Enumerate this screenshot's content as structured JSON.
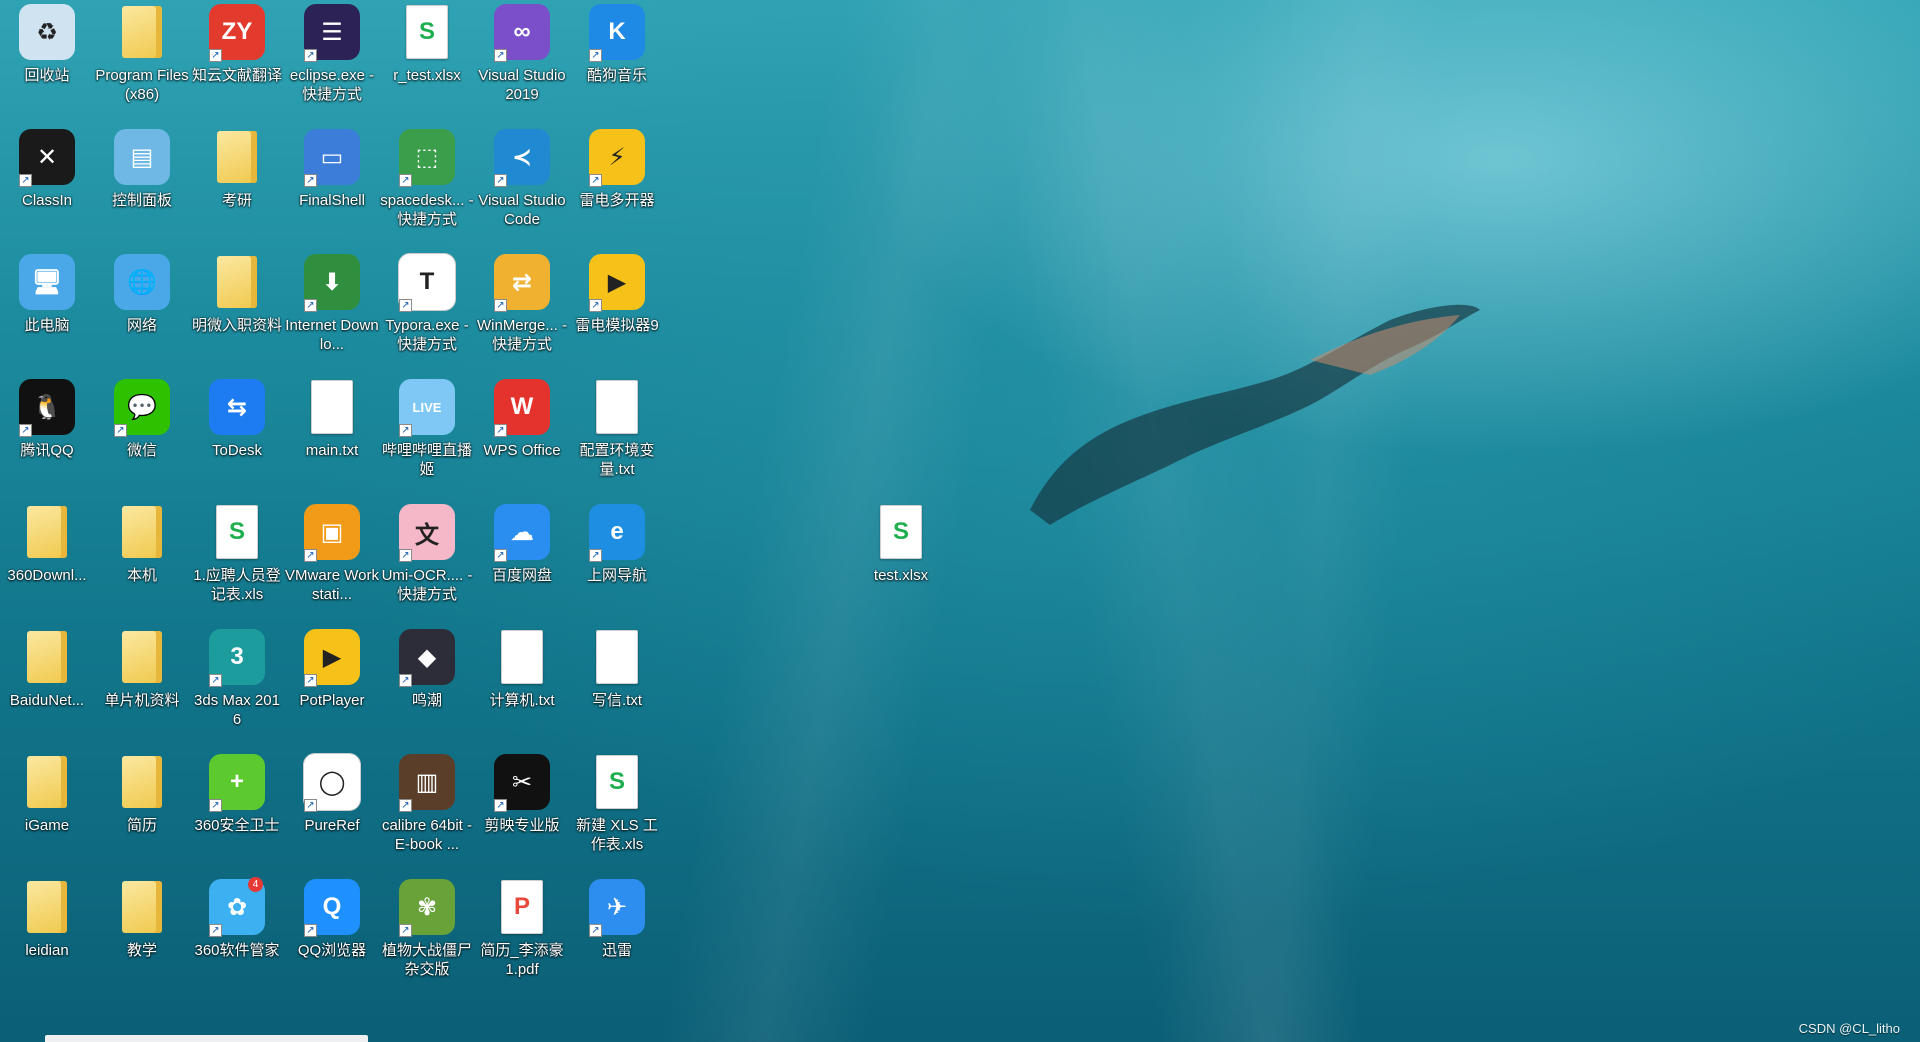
{
  "desktop": {
    "icons": [
      {
        "id": "recycle",
        "label": "回收站",
        "type": "system",
        "icon": "recycle-bin-icon",
        "color": "#cfe3f0",
        "glyph": "♻",
        "shortcut": false
      },
      {
        "id": "progfiles",
        "label": "Program Files (x86)",
        "type": "folder",
        "icon": "folder-icon",
        "shortcut": false
      },
      {
        "id": "zhiyun",
        "label": "知云文献翻译",
        "type": "app",
        "icon": "zhiyun-icon",
        "color": "#e23b2e",
        "glyph": "ZY",
        "shortcut": true
      },
      {
        "id": "eclipse",
        "label": "eclipse.exe - 快捷方式",
        "type": "app",
        "icon": "eclipse-icon",
        "color": "#2c2255",
        "glyph": "☰",
        "shortcut": true
      },
      {
        "id": "rtest",
        "label": "r_test.xlsx",
        "type": "doc",
        "icon": "spreadsheet-icon",
        "color": "#1fae4e",
        "glyph": "S",
        "shortcut": false
      },
      {
        "id": "vs2019",
        "label": "Visual Studio 2019",
        "type": "app",
        "icon": "visual-studio-icon",
        "color": "#7a4fc9",
        "glyph": "∞",
        "shortcut": true
      },
      {
        "id": "kugou",
        "label": "酷狗音乐",
        "type": "app",
        "icon": "kugou-icon",
        "color": "#1f8ae6",
        "glyph": "K",
        "shortcut": true
      },
      {
        "id": "classin",
        "label": "ClassIn",
        "type": "app",
        "icon": "classin-icon",
        "color": "#1a1a1a",
        "glyph": "✕",
        "shortcut": true
      },
      {
        "id": "control",
        "label": "控制面板",
        "type": "system",
        "icon": "control-panel-icon",
        "color": "#6fb8e6",
        "glyph": "▤",
        "shortcut": false
      },
      {
        "id": "kaoyan",
        "label": "考研",
        "type": "folder",
        "icon": "folder-icon",
        "shortcut": false
      },
      {
        "id": "finalshell",
        "label": "FinalShell",
        "type": "app",
        "icon": "finalshell-icon",
        "color": "#3b7dd8",
        "glyph": "▭",
        "shortcut": true
      },
      {
        "id": "spacedesk",
        "label": "spacedesk... - 快捷方式",
        "type": "app",
        "icon": "spacedesk-icon",
        "color": "#3a9e4a",
        "glyph": "⬚",
        "shortcut": true
      },
      {
        "id": "vscode",
        "label": "Visual Studio Code",
        "type": "app",
        "icon": "vscode-icon",
        "color": "#1f8ad2",
        "glyph": "≺",
        "shortcut": true
      },
      {
        "id": "ldmulti",
        "label": "雷电多开器",
        "type": "app",
        "icon": "leidian-multi-icon",
        "color": "#f6c21a",
        "glyph": "⚡",
        "shortcut": true
      },
      {
        "id": "thispc",
        "label": "此电脑",
        "type": "system",
        "icon": "computer-icon",
        "color": "#4aa8e8",
        "glyph": "🖥",
        "shortcut": false
      },
      {
        "id": "network",
        "label": "网络",
        "type": "system",
        "icon": "network-icon",
        "color": "#4aa8e8",
        "glyph": "🌐",
        "shortcut": false
      },
      {
        "id": "mingwei",
        "label": "明微入职资料",
        "type": "folder",
        "icon": "folder-icon",
        "shortcut": false
      },
      {
        "id": "idm",
        "label": "Internet Downlo...",
        "type": "app",
        "icon": "idm-icon",
        "color": "#2f8f3f",
        "glyph": "⬇",
        "shortcut": true
      },
      {
        "id": "typora",
        "label": "Typora.exe - 快捷方式",
        "type": "app",
        "icon": "typora-icon",
        "color": "#ffffff",
        "glyph": "T",
        "shortcut": true
      },
      {
        "id": "winmerge",
        "label": "WinMerge... - 快捷方式",
        "type": "app",
        "icon": "winmerge-icon",
        "color": "#f0b030",
        "glyph": "⇄",
        "shortcut": true
      },
      {
        "id": "ld9",
        "label": "雷电模拟器9",
        "type": "app",
        "icon": "leidian-emulator-icon",
        "color": "#f6c21a",
        "glyph": "▶",
        "shortcut": true
      },
      {
        "id": "qq",
        "label": "腾讯QQ",
        "type": "app",
        "icon": "qq-penguin-icon",
        "color": "#111111",
        "glyph": "🐧",
        "shortcut": true
      },
      {
        "id": "wechat",
        "label": "微信",
        "type": "app",
        "icon": "wechat-icon",
        "color": "#2dc100",
        "glyph": "💬",
        "shortcut": true
      },
      {
        "id": "todesk",
        "label": "ToDesk",
        "type": "app",
        "icon": "todesk-icon",
        "color": "#1e7cf2",
        "glyph": "⇆",
        "shortcut": false
      },
      {
        "id": "maintxt",
        "label": "main.txt",
        "type": "doc",
        "icon": "text-file-icon",
        "shortcut": false
      },
      {
        "id": "bilibili",
        "label": "哔哩哔哩直播姬",
        "type": "app",
        "icon": "bilibili-live-icon",
        "color": "#7fc8f5",
        "glyph": "LIVE",
        "shortcut": true
      },
      {
        "id": "wps",
        "label": "WPS Office",
        "type": "app",
        "icon": "wps-icon",
        "color": "#e4332c",
        "glyph": "W",
        "shortcut": true
      },
      {
        "id": "envtxt",
        "label": "配置环境变量.txt",
        "type": "doc",
        "icon": "text-file-icon",
        "shortcut": false
      },
      {
        "id": "dl360",
        "label": "360Downl...",
        "type": "folder",
        "icon": "folder-icon",
        "shortcut": false
      },
      {
        "id": "benji",
        "label": "本机",
        "type": "folder",
        "icon": "folder-icon",
        "shortcut": false
      },
      {
        "id": "recruit",
        "label": "1.应聘人员登记表.xls",
        "type": "doc",
        "icon": "spreadsheet-icon",
        "color": "#1fae4e",
        "glyph": "S",
        "shortcut": false
      },
      {
        "id": "vmware",
        "label": "VMware Workstati...",
        "type": "app",
        "icon": "vmware-icon",
        "color": "#f29b18",
        "glyph": "▣",
        "shortcut": true
      },
      {
        "id": "umiocr",
        "label": "Umi-OCR.... - 快捷方式",
        "type": "app",
        "icon": "umi-ocr-icon",
        "color": "#f5b8c9",
        "glyph": "文",
        "shortcut": true
      },
      {
        "id": "baidupan",
        "label": "百度网盘",
        "type": "app",
        "icon": "baidu-netdisk-icon",
        "color": "#2a8df0",
        "glyph": "☁",
        "shortcut": true
      },
      {
        "id": "ie",
        "label": "上网导航",
        "type": "app",
        "icon": "ie-browser-icon",
        "color": "#1e8ee3",
        "glyph": "e",
        "shortcut": true
      },
      {
        "id": "baidunet",
        "label": "BaiduNet...",
        "type": "folder",
        "icon": "folder-icon",
        "shortcut": false
      },
      {
        "id": "mcu",
        "label": "单片机资料",
        "type": "folder",
        "icon": "folder-icon",
        "shortcut": false
      },
      {
        "id": "3dsmax",
        "label": "3ds Max 2016",
        "type": "app",
        "icon": "3ds-max-icon",
        "color": "#1c9c9c",
        "glyph": "3",
        "shortcut": true
      },
      {
        "id": "potplayer",
        "label": "PotPlayer",
        "type": "app",
        "icon": "potplayer-icon",
        "color": "#f6c21a",
        "glyph": "▶",
        "shortcut": true
      },
      {
        "id": "mingchao",
        "label": "鸣潮",
        "type": "app",
        "icon": "wuthering-waves-icon",
        "color": "#2d2d3a",
        "glyph": "◆",
        "shortcut": true
      },
      {
        "id": "jisuanji",
        "label": "计算机.txt",
        "type": "doc",
        "icon": "text-file-icon",
        "shortcut": false
      },
      {
        "id": "xiexin",
        "label": "写信.txt",
        "type": "doc",
        "icon": "text-file-icon",
        "shortcut": false
      },
      {
        "id": "igame",
        "label": "iGame",
        "type": "folder",
        "icon": "folder-icon",
        "shortcut": false
      },
      {
        "id": "jianli",
        "label": "简历",
        "type": "folder",
        "icon": "folder-icon",
        "shortcut": false
      },
      {
        "id": "s360",
        "label": "360安全卫士",
        "type": "app",
        "icon": "360-safe-icon",
        "color": "#5cc92e",
        "glyph": "+",
        "shortcut": true
      },
      {
        "id": "pureref",
        "label": "PureRef",
        "type": "app",
        "icon": "pureref-icon",
        "color": "#ffffff",
        "glyph": "◯",
        "shortcut": true
      },
      {
        "id": "calibre",
        "label": "calibre 64bit - E-book ...",
        "type": "app",
        "icon": "calibre-icon",
        "color": "#5a3e2a",
        "glyph": "▥",
        "shortcut": true
      },
      {
        "id": "jianying",
        "label": "剪映专业版",
        "type": "app",
        "icon": "capcut-icon",
        "color": "#111111",
        "glyph": "✂",
        "shortcut": true
      },
      {
        "id": "newxls",
        "label": "新建 XLS 工作表.xls",
        "type": "doc",
        "icon": "spreadsheet-icon",
        "color": "#1fae4e",
        "glyph": "S",
        "shortcut": false
      },
      {
        "id": "leidian",
        "label": "leidian",
        "type": "folder",
        "icon": "folder-icon",
        "shortcut": false
      },
      {
        "id": "jiaoxue",
        "label": "教学",
        "type": "folder",
        "icon": "folder-icon",
        "shortcut": false
      },
      {
        "id": "soft360",
        "label": "360软件管家",
        "type": "app",
        "icon": "360-software-manager-icon",
        "color": "#3cb0f0",
        "glyph": "✿",
        "shortcut": true,
        "badge": "4"
      },
      {
        "id": "qqbrowser",
        "label": "QQ浏览器",
        "type": "app",
        "icon": "qq-browser-icon",
        "color": "#1e90ff",
        "glyph": "Q",
        "shortcut": true
      },
      {
        "id": "pvz",
        "label": "植物大战僵尸杂交版",
        "type": "app",
        "icon": "plants-vs-zombies-icon",
        "color": "#6aa23a",
        "glyph": "✾",
        "shortcut": true
      },
      {
        "id": "jianlipdf",
        "label": "简历_李添豪1.pdf",
        "type": "doc",
        "icon": "pdf-icon",
        "color": "#e64a3c",
        "glyph": "P",
        "shortcut": false
      },
      {
        "id": "xunlei",
        "label": "迅雷",
        "type": "app",
        "icon": "xunlei-icon",
        "color": "#2e8ef0",
        "glyph": "✈",
        "shortcut": true
      },
      {
        "id": "testxlsx",
        "label": "test.xlsx",
        "type": "doc",
        "icon": "spreadsheet-icon",
        "color": "#1fae4e",
        "glyph": "S",
        "shortcut": false
      }
    ]
  },
  "watermark": "CSDN @CL_litho"
}
